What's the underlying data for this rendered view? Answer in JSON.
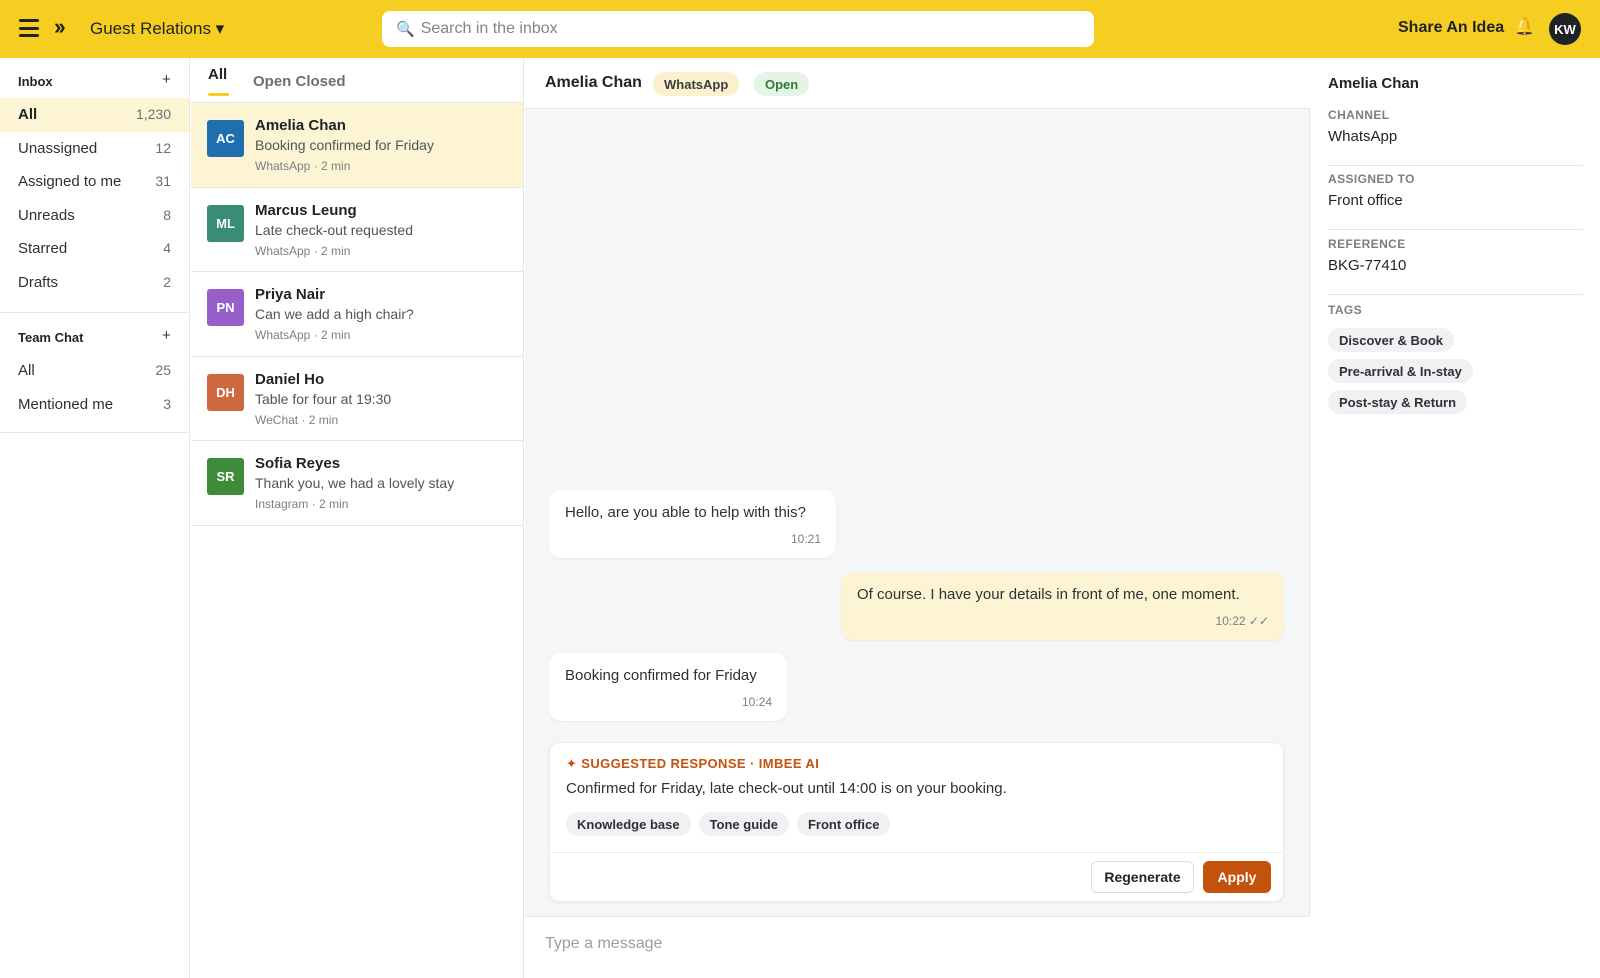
{
  "topbar": {
    "workspace": "Guest Relations ▾",
    "search_placeholder": "Search in the inbox",
    "share_idea": "Share An Idea",
    "user_initials": "KW"
  },
  "sidebar": {
    "inbox_title": "Inbox",
    "inbox_items": [
      {
        "label": "All",
        "count": "1,230"
      },
      {
        "label": "Unassigned",
        "count": "12"
      },
      {
        "label": "Assigned to me",
        "count": "31"
      },
      {
        "label": "Unreads",
        "count": "8"
      },
      {
        "label": "Starred",
        "count": "4"
      },
      {
        "label": "Drafts",
        "count": "2"
      }
    ],
    "team_title": "Team Chat",
    "team_items": [
      {
        "label": "All",
        "count": "25"
      },
      {
        "label": "Mentioned me",
        "count": "3"
      }
    ]
  },
  "conversation_list": {
    "tab_all": "All",
    "tab_open_closed": "Open Closed",
    "conversations": [
      {
        "initials": "AC",
        "color": "#1f6fae",
        "name": "Amelia Chan",
        "preview": "Booking confirmed for Friday",
        "meta": "WhatsApp · 2 min"
      },
      {
        "initials": "ML",
        "color": "#3a8b78",
        "name": "Marcus Leung",
        "preview": "Late check-out requested",
        "meta": "WhatsApp · 2 min"
      },
      {
        "initials": "PN",
        "color": "#9660c8",
        "name": "Priya Nair",
        "preview": "Can we add a high chair?",
        "meta": "WhatsApp · 2 min"
      },
      {
        "initials": "DH",
        "color": "#cf6841",
        "name": "Daniel Ho",
        "preview": "Table for four at 19:30",
        "meta": "WeChat · 2 min"
      },
      {
        "initials": "SR",
        "color": "#3e8b3a",
        "name": "Sofia Reyes",
        "preview": "Thank you, we had a lovely stay",
        "meta": "Instagram · 2 min"
      }
    ]
  },
  "chat": {
    "contact_name": "Amelia Chan",
    "channel_pill": "WhatsApp",
    "status_pill": "Open",
    "messages": [
      {
        "text": "Hello, are you able to help with this?",
        "time": "10:21"
      },
      {
        "text": "Of course. I have your details in front of me, one moment.",
        "time": "10:22 ✓✓"
      },
      {
        "text": "Booking confirmed for Friday",
        "time": "10:24"
      }
    ],
    "suggestion": {
      "header": "✦ SUGGESTED RESPONSE · IMBEE AI",
      "text": "Confirmed for Friday, late check-out until 14:00 is on your booking.",
      "sources": [
        "Knowledge base",
        "Tone guide",
        "Front office"
      ],
      "regenerate": "Regenerate",
      "apply": "Apply"
    },
    "composer_placeholder": "Type a message"
  },
  "details": {
    "name": "Amelia Chan",
    "channel_label": "CHANNEL",
    "channel_value": "WhatsApp",
    "assigned_label": "ASSIGNED TO",
    "assigned_value": "Front office",
    "reference_label": "REFERENCE",
    "reference_value": "BKG-77410",
    "tags_label": "TAGS",
    "tags": [
      "Discover & Book",
      "Pre-arrival & In-stay",
      "Post-stay & Return"
    ]
  },
  "colors": {
    "brand_yellow": "#f6cd21",
    "accent_orange": "#c2520c",
    "active_row": "#fdf4d3"
  }
}
